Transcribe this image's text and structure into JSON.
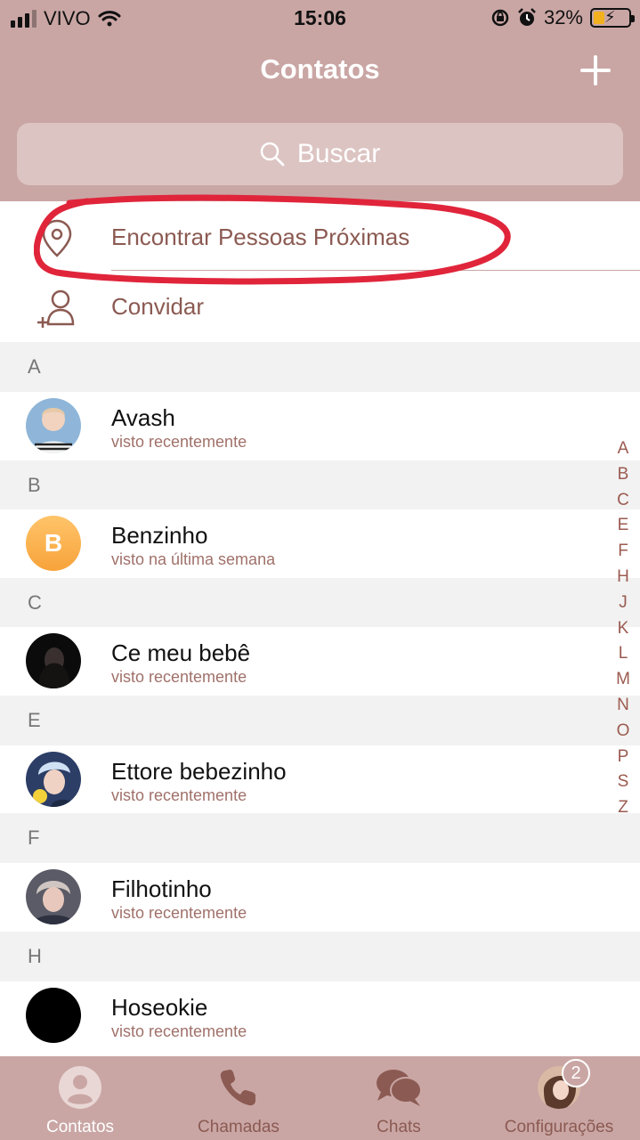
{
  "status_bar": {
    "carrier": "VIVO",
    "time": "15:06",
    "battery": "32%",
    "battery_level": 0.32
  },
  "header": {
    "title": "Contatos",
    "search_placeholder": "Buscar"
  },
  "actions": {
    "find_nearby": "Encontrar Pessoas Próximas",
    "invite": "Convidar"
  },
  "sections": [
    {
      "letter": "A",
      "contacts": [
        {
          "name": "Avash",
          "status": "visto recentemente"
        }
      ]
    },
    {
      "letter": "B",
      "contacts": [
        {
          "name": "Benzinho",
          "status": "visto na última semana",
          "initial": "B"
        }
      ]
    },
    {
      "letter": "C",
      "contacts": [
        {
          "name": "Ce meu bebê",
          "status": "visto recentemente"
        }
      ]
    },
    {
      "letter": "E",
      "contacts": [
        {
          "name": "Ettore bebezinho",
          "status": "visto recentemente"
        }
      ]
    },
    {
      "letter": "F",
      "contacts": [
        {
          "name": "Filhotinho",
          "status": "visto recentemente"
        }
      ]
    },
    {
      "letter": "H",
      "contacts": [
        {
          "name": "Hoseokie",
          "status": "visto recentemente"
        }
      ]
    }
  ],
  "alphabet_index": [
    "A",
    "B",
    "C",
    "E",
    "F",
    "H",
    "J",
    "K",
    "L",
    "M",
    "N",
    "O",
    "P",
    "S",
    "Z"
  ],
  "tabs": [
    {
      "label": "Contatos",
      "icon": "person-icon"
    },
    {
      "label": "Chamadas",
      "icon": "phone-icon"
    },
    {
      "label": "Chats",
      "icon": "chat-bubbles-icon"
    },
    {
      "label": "Configurações",
      "icon": "profile-photo",
      "badge": "2"
    }
  ],
  "colors": {
    "header_bg": "#c9a6a4",
    "accent_text": "#8b5a52",
    "highlight_ring": "#e0253b"
  }
}
